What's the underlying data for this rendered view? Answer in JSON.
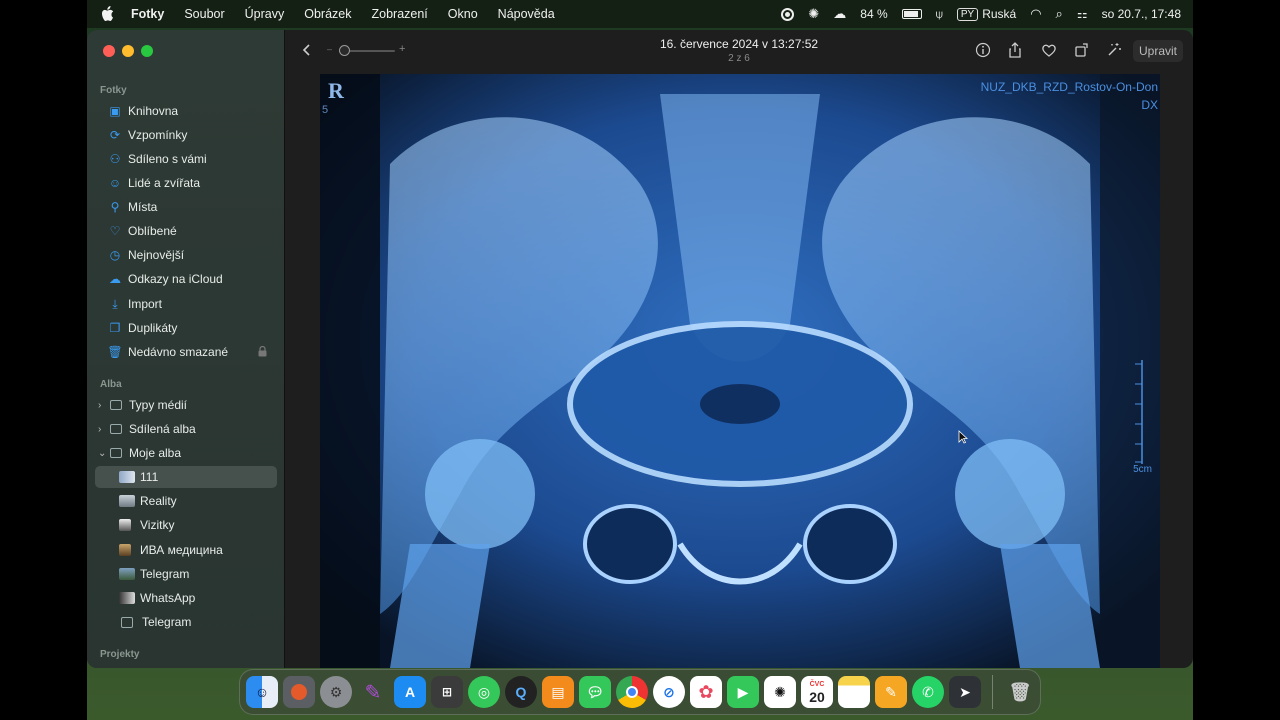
{
  "menubar": {
    "app": "Fotky",
    "items": [
      "Soubor",
      "Úpravy",
      "Obrázek",
      "Zobrazení",
      "Okno",
      "Nápověda"
    ],
    "battery": "84 %",
    "input_source": "PY",
    "input_language": "Ruská",
    "datetime": "so 20.7., 17:48"
  },
  "sidebar": {
    "section_photos": "Fotky",
    "items": [
      {
        "label": "Knihovna",
        "icon": "library-icon"
      },
      {
        "label": "Vzpomínky",
        "icon": "memories-icon"
      },
      {
        "label": "Sdíleno s vámi",
        "icon": "shared-with-you-icon"
      },
      {
        "label": "Lidé a zvířata",
        "icon": "people-icon"
      },
      {
        "label": "Místa",
        "icon": "places-icon"
      },
      {
        "label": "Oblíbené",
        "icon": "heart-icon"
      },
      {
        "label": "Nejnovější",
        "icon": "clock-icon"
      },
      {
        "label": "Odkazy na iCloud",
        "icon": "icloud-icon"
      },
      {
        "label": "Import",
        "icon": "import-icon"
      },
      {
        "label": "Duplikáty",
        "icon": "duplicates-icon"
      },
      {
        "label": "Nedávno smazané",
        "icon": "trash-icon"
      }
    ],
    "section_albums": "Alba",
    "album_groups": [
      "Typy médií",
      "Sdílená alba",
      "Moje alba"
    ],
    "albums": [
      {
        "label": "111",
        "selected": true
      },
      {
        "label": "Reality",
        "selected": false
      },
      {
        "label": "Vizitky",
        "selected": false
      },
      {
        "label": "ИВА медицина",
        "selected": false
      },
      {
        "label": "Telegram",
        "selected": false
      },
      {
        "label": "WhatsApp",
        "selected": false
      },
      {
        "label": "Telegram",
        "selected": false
      }
    ],
    "section_projects": "Projekty"
  },
  "toolbar": {
    "title": "16. července 2024 v 13:27:52",
    "subtitle": "2 z 6",
    "edit_label": "Upravit"
  },
  "photo": {
    "label_top": "NUZ_DKB_RZD_Rostov-On-Don",
    "label_dx": "DX",
    "label_r": "R",
    "label_scale": "5cm",
    "label_5": "5"
  },
  "dock": {
    "calendar_month": "ČVC",
    "calendar_day": "20",
    "apps": [
      "finder-icon",
      "launchpad-icon",
      "settings-icon",
      "feather-icon",
      "app-store-icon",
      "calculator-icon",
      "find-my-icon",
      "quicktime-icon",
      "books-icon",
      "messages-icon",
      "chrome-icon",
      "safari-icon",
      "photos-icon",
      "facetime-icon",
      "chatgpt-icon",
      "calendar-icon",
      "notes-icon",
      "pages-icon",
      "whatsapp-icon",
      "telegram-icon",
      "trash-icon"
    ]
  }
}
